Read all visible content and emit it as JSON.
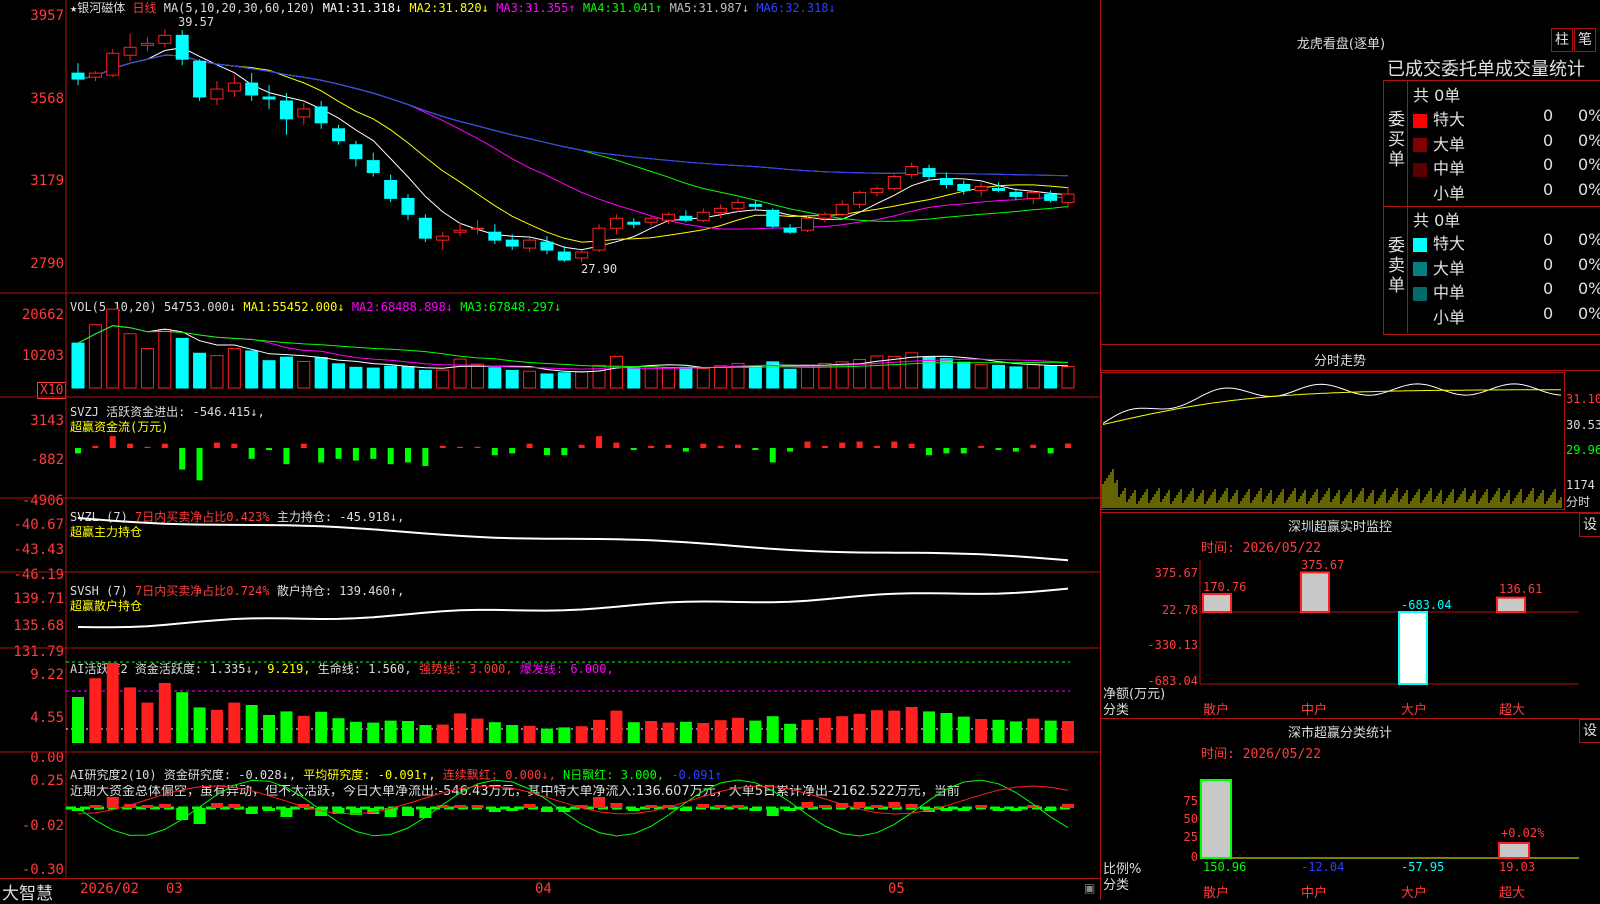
{
  "main": {
    "stock_name": "银河磁体",
    "period": "日线",
    "ma_label": "MA(5,10,20,30,60,120)",
    "ma_values": [
      {
        "name": "MA1:",
        "value": "31.318↓",
        "color": "#ffffff"
      },
      {
        "name": "MA2:",
        "value": "31.820↓",
        "color": "#ffff00"
      },
      {
        "name": "MA3:",
        "value": "31.355↑",
        "color": "#ff00ff"
      },
      {
        "name": "MA4:",
        "value": "31.041↑",
        "color": "#00ff00"
      },
      {
        "name": "MA5:",
        "value": "31.987↓",
        "color": "#c0c0c0"
      },
      {
        "name": "MA6:",
        "value": "32.318↓",
        "color": "#3040ff"
      }
    ],
    "y_ticks": [
      "3957",
      "3568",
      "3179",
      "2790"
    ],
    "high_label": "39.57",
    "low_label": "27.90"
  },
  "vol": {
    "label": "VOL(5,10,20)",
    "value": "54753.000↓",
    "mas": [
      {
        "name": "MA1:",
        "value": "55452.000↓",
        "color": "#ffffff"
      },
      {
        "name": "MA2:",
        "value": "68488.898↓",
        "color": "#ff00ff"
      },
      {
        "name": "MA3:",
        "value": "67848.297↓",
        "color": "#00ff00"
      }
    ],
    "y_ticks": [
      "20662",
      "10203"
    ],
    "unit": "X10"
  },
  "svzj": {
    "label": "SVZJ",
    "desc": "活跃资金进出: -546.415↓,",
    "sub": "超赢资金流(万元)",
    "y_ticks": [
      "3143",
      "-882",
      "-4906"
    ]
  },
  "svzl": {
    "label": "SVZL (7)",
    "desc": "7日内买卖净占比0.423%",
    "extra": "主力持仓: -45.918↓,",
    "sub": "超赢主力持仓",
    "y_ticks": [
      "-40.67",
      "-43.43",
      "-46.19"
    ]
  },
  "svsh": {
    "label": "SVSH (7)",
    "desc": "7日内买卖净占比0.724%",
    "extra": "散户持仓: 139.460↑,",
    "sub": "超赢散户持仓",
    "y_ticks": [
      "139.71",
      "135.68",
      "131.79"
    ]
  },
  "ai1": {
    "label": "AI活跃度2",
    "v1": "资金活跃度: 1.335↓,",
    "v2": "9.219,",
    "v3": "生命线: 1.560,",
    "v4": "强势线: 3.000,",
    "v5": "爆发线: 6.000,",
    "y_ticks": [
      "9.22",
      "4.55",
      "0.00"
    ]
  },
  "ai2": {
    "label": "AI研究度2(10)",
    "v1": "资金研究度: -0.028↓,",
    "v2": "平均研究度: -0.091↑,",
    "v3": "连续飘红: 0.000↓,",
    "v4": "N日飘红: 3.000,",
    "v5": "-0.091↑",
    "comment": "近期大资金总体偏空，虽有异动，但不太活跃，今日大单净流出:-546.43万元，其中特大单净流入:136.607万元，大单5日累计净出-2162.522万元，当前",
    "y_ticks": [
      "0.25",
      "-0.02",
      "-0.30"
    ]
  },
  "footer": {
    "brand": "大智慧",
    "dates": [
      "2026/02",
      "03",
      "04",
      "05"
    ]
  },
  "right": {
    "top_title": "龙虎看盘(逐单)",
    "btn_zhu": "柱",
    "btn_bi": "笔",
    "subtitle": "已成交委托单成交量统计",
    "buy_group": "委买单",
    "sell_group": "委卖单",
    "buy_total": "共 0单",
    "sell_total": "共 0单",
    "rows_buy": [
      {
        "name": "特大",
        "qty": "0",
        "pct": "0%",
        "color": "#ff0000"
      },
      {
        "name": "大单",
        "qty": "0",
        "pct": "0%",
        "color": "#800000"
      },
      {
        "name": "中单",
        "qty": "0",
        "pct": "0%",
        "color": "#5a0000"
      },
      {
        "name": "小单",
        "qty": "0",
        "pct": "0%",
        "color": "#000000"
      }
    ],
    "rows_sell": [
      {
        "name": "特大",
        "qty": "0",
        "pct": "0%",
        "color": "#00ffff"
      },
      {
        "name": "大单",
        "qty": "0",
        "pct": "0%",
        "color": "#008080"
      },
      {
        "name": "中单",
        "qty": "0",
        "pct": "0%",
        "color": "#006a6a"
      },
      {
        "name": "小单",
        "qty": "0",
        "pct": "0%",
        "color": "#000000"
      }
    ],
    "intraday_title": "分时走势",
    "intraday_ticks": [
      "31.10",
      "30.53",
      "29.96",
      "1174",
      "分时"
    ],
    "sz_title": "深圳超赢实时监控",
    "sz_date": "时间: 2026/05/22",
    "sz_ticks": [
      "375.67",
      "22.78",
      "-330.13",
      "-683.04"
    ],
    "sz_values": [
      "170.76",
      "375.67",
      "-683.04",
      "136.61"
    ],
    "sz_cats": [
      "散户",
      "中户",
      "大户",
      "超大"
    ],
    "sz_axis_label": "净额(万元)",
    "sz_axis_label2": "分类",
    "sh_title": "深市超赢分类统计",
    "sh_date": "时间: 2026/05/22",
    "sh_ticks": [
      "75",
      "50",
      "25",
      "0"
    ],
    "sh_values": [
      "150.96",
      "-12.04",
      "-57.95",
      "19.03"
    ],
    "sh_cats": [
      "散户",
      "中户",
      "大户",
      "超大"
    ],
    "sh_extra": "+0.02%",
    "sh_axis_label": "比例%",
    "sh_axis_label2": "分类",
    "set_label": "设"
  },
  "chart_data": {
    "type": "candlestick",
    "title": "银河磁体 日线",
    "ohlc": [
      [
        37.4,
        37.9,
        36.8,
        37.1
      ],
      [
        37.2,
        37.5,
        37.0,
        37.4
      ],
      [
        37.3,
        38.6,
        37.2,
        38.4
      ],
      [
        38.3,
        39.4,
        38.0,
        38.7
      ],
      [
        38.8,
        39.2,
        38.5,
        38.9
      ],
      [
        38.9,
        39.6,
        38.7,
        39.3
      ],
      [
        39.3,
        39.57,
        37.8,
        38.1
      ],
      [
        38.0,
        38.1,
        36.0,
        36.2
      ],
      [
        36.1,
        37.0,
        35.8,
        36.6
      ],
      [
        36.5,
        37.3,
        36.2,
        36.9
      ],
      [
        36.9,
        37.4,
        36.0,
        36.3
      ],
      [
        36.2,
        36.8,
        35.6,
        36.1
      ],
      [
        36.0,
        36.4,
        34.3,
        35.1
      ],
      [
        35.2,
        35.9,
        34.8,
        35.6
      ],
      [
        35.7,
        36.0,
        34.6,
        34.9
      ],
      [
        34.6,
        34.8,
        33.8,
        34.0
      ],
      [
        33.8,
        34.0,
        32.7,
        33.1
      ],
      [
        33.0,
        33.4,
        32.2,
        32.4
      ],
      [
        32.0,
        32.3,
        30.9,
        31.1
      ],
      [
        31.1,
        31.3,
        30.0,
        30.3
      ],
      [
        30.1,
        30.3,
        28.9,
        29.1
      ],
      [
        29.0,
        29.4,
        28.5,
        29.2
      ],
      [
        29.4,
        29.9,
        29.2,
        29.5
      ],
      [
        29.6,
        30.0,
        29.3,
        29.6
      ],
      [
        29.4,
        29.8,
        28.8,
        29.0
      ],
      [
        29.0,
        29.3,
        28.5,
        28.7
      ],
      [
        28.6,
        29.1,
        28.4,
        29.0
      ],
      [
        28.9,
        29.2,
        28.3,
        28.5
      ],
      [
        28.4,
        28.7,
        27.9,
        28.0
      ],
      [
        28.1,
        28.5,
        27.9,
        28.4
      ],
      [
        28.5,
        29.8,
        28.4,
        29.6
      ],
      [
        29.6,
        30.3,
        29.3,
        30.1
      ],
      [
        29.9,
        30.1,
        29.6,
        29.8
      ],
      [
        29.9,
        30.2,
        29.7,
        30.1
      ],
      [
        30.0,
        30.4,
        29.8,
        30.3
      ],
      [
        30.2,
        30.5,
        29.9,
        30.0
      ],
      [
        30.0,
        30.6,
        29.9,
        30.4
      ],
      [
        30.4,
        30.8,
        30.1,
        30.6
      ],
      [
        30.6,
        31.1,
        30.4,
        30.9
      ],
      [
        30.8,
        31.0,
        30.5,
        30.7
      ],
      [
        30.5,
        30.6,
        29.6,
        29.7
      ],
      [
        29.6,
        29.8,
        29.3,
        29.4
      ],
      [
        29.5,
        30.2,
        29.4,
        30.1
      ],
      [
        30.1,
        30.4,
        29.9,
        30.3
      ],
      [
        30.3,
        31.0,
        30.2,
        30.8
      ],
      [
        30.8,
        31.5,
        30.6,
        31.4
      ],
      [
        31.4,
        31.7,
        31.2,
        31.6
      ],
      [
        31.6,
        32.3,
        31.5,
        32.2
      ],
      [
        32.3,
        32.9,
        32.1,
        32.7
      ],
      [
        32.6,
        32.8,
        32.0,
        32.2
      ],
      [
        32.1,
        32.4,
        31.6,
        31.8
      ],
      [
        31.8,
        32.0,
        31.3,
        31.5
      ],
      [
        31.5,
        31.9,
        31.2,
        31.7
      ],
      [
        31.6,
        31.9,
        31.4,
        31.5
      ],
      [
        31.4,
        31.6,
        31.0,
        31.2
      ],
      [
        31.1,
        31.5,
        30.8,
        31.4
      ],
      [
        31.3,
        31.5,
        30.9,
        31.0
      ],
      [
        30.9,
        31.7,
        30.6,
        31.32
      ]
    ],
    "volume": [
      11.5,
      16.2,
      20.2,
      13.9,
      10.1,
      15.0,
      12.7,
      8.9,
      8.3,
      10.1,
      9.5,
      7.0,
      7.9,
      6.8,
      7.8,
      6.2,
      5.3,
      5.1,
      5.6,
      5.5,
      4.5,
      4.6,
      7.4,
      6.1,
      5.2,
      4.5,
      4.3,
      3.6,
      3.9,
      4.2,
      5.8,
      8.1,
      5.2,
      5.5,
      5.1,
      5.3,
      5.0,
      5.7,
      6.3,
      5.6,
      6.7,
      4.8,
      5.8,
      6.3,
      6.7,
      7.3,
      8.2,
      8.1,
      9.0,
      7.9,
      7.5,
      6.6,
      6.0,
      5.8,
      5.4,
      6.1,
      5.6,
      5.5
    ],
    "ylim": [
      27.9,
      39.57
    ],
    "x_ticks": [
      "2026/02",
      "03",
      "04",
      "05"
    ]
  }
}
